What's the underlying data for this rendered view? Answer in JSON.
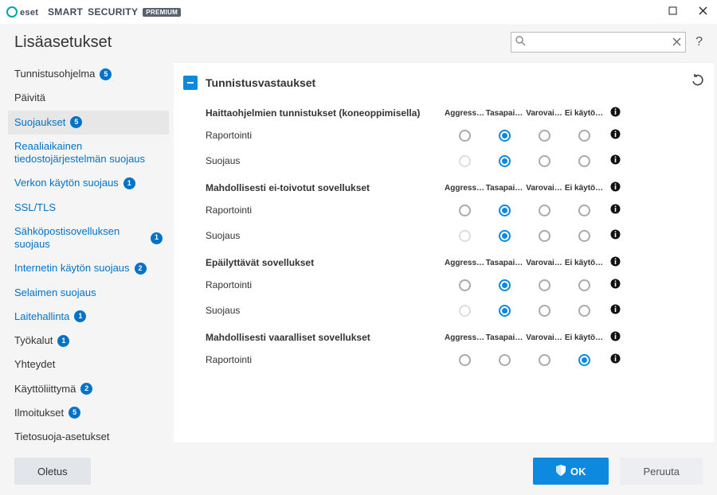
{
  "titlebar": {
    "brand_word1": "SMART",
    "brand_word2": "SECURITY",
    "premium": "PREMIUM"
  },
  "header": {
    "title": "Lisäasetukset",
    "search_placeholder": "",
    "help": "?"
  },
  "sidebar": {
    "items": [
      {
        "label": "Tunnistusohjelma",
        "badge": "5",
        "link": false,
        "active": false
      },
      {
        "label": "Päivitä",
        "badge": "",
        "link": false,
        "active": false
      },
      {
        "label": "Suojaukset",
        "badge": "5",
        "link": true,
        "active": true
      },
      {
        "label": "Reaaliaikainen tiedostojärjestelmän suojaus",
        "badge": "",
        "link": true,
        "active": false
      },
      {
        "label": "Verkon käytön suojaus",
        "badge": "1",
        "link": true,
        "active": false
      },
      {
        "label": "SSL/TLS",
        "badge": "",
        "link": true,
        "active": false
      },
      {
        "label": "Sähköpostisovelluksen suojaus",
        "badge": "1",
        "link": true,
        "active": false
      },
      {
        "label": "Internetin käytön suojaus",
        "badge": "2",
        "link": true,
        "active": false
      },
      {
        "label": "Selaimen suojaus",
        "badge": "",
        "link": true,
        "active": false
      },
      {
        "label": "Laitehallinta",
        "badge": "1",
        "link": true,
        "active": false
      },
      {
        "label": "Työkalut",
        "badge": "1",
        "link": false,
        "active": false
      },
      {
        "label": "Yhteydet",
        "badge": "",
        "link": false,
        "active": false
      },
      {
        "label": "Käyttöliittymä",
        "badge": "2",
        "link": false,
        "active": false
      },
      {
        "label": "Ilmoitukset",
        "badge": "5",
        "link": false,
        "active": false
      },
      {
        "label": "Tietosuoja-asetukset",
        "badge": "",
        "link": false,
        "active": false
      }
    ]
  },
  "main": {
    "section_title": "Tunnistusvastaukset",
    "columns": [
      "Aggress…",
      "Tasapai…",
      "Varovai…",
      "Ei käytö…"
    ],
    "groups": [
      {
        "title": "Haittaohjelmien tunnistukset (koneoppimisella)",
        "rows": [
          {
            "label": "Raportointi",
            "selected": 1,
            "disabled": []
          },
          {
            "label": "Suojaus",
            "selected": 1,
            "disabled": [
              0
            ]
          }
        ]
      },
      {
        "title": "Mahdollisesti ei-toivotut sovellukset",
        "rows": [
          {
            "label": "Raportointi",
            "selected": 1,
            "disabled": []
          },
          {
            "label": "Suojaus",
            "selected": 1,
            "disabled": [
              0
            ]
          }
        ]
      },
      {
        "title": "Epäilyttävät sovellukset",
        "rows": [
          {
            "label": "Raportointi",
            "selected": 1,
            "disabled": []
          },
          {
            "label": "Suojaus",
            "selected": 1,
            "disabled": [
              0
            ]
          }
        ]
      },
      {
        "title": "Mahdollisesti vaaralliset sovellukset",
        "rows": [
          {
            "label": "Raportointi",
            "selected": 3,
            "disabled": []
          }
        ]
      }
    ]
  },
  "footer": {
    "default": "Oletus",
    "ok": "OK",
    "cancel": "Peruuta"
  }
}
